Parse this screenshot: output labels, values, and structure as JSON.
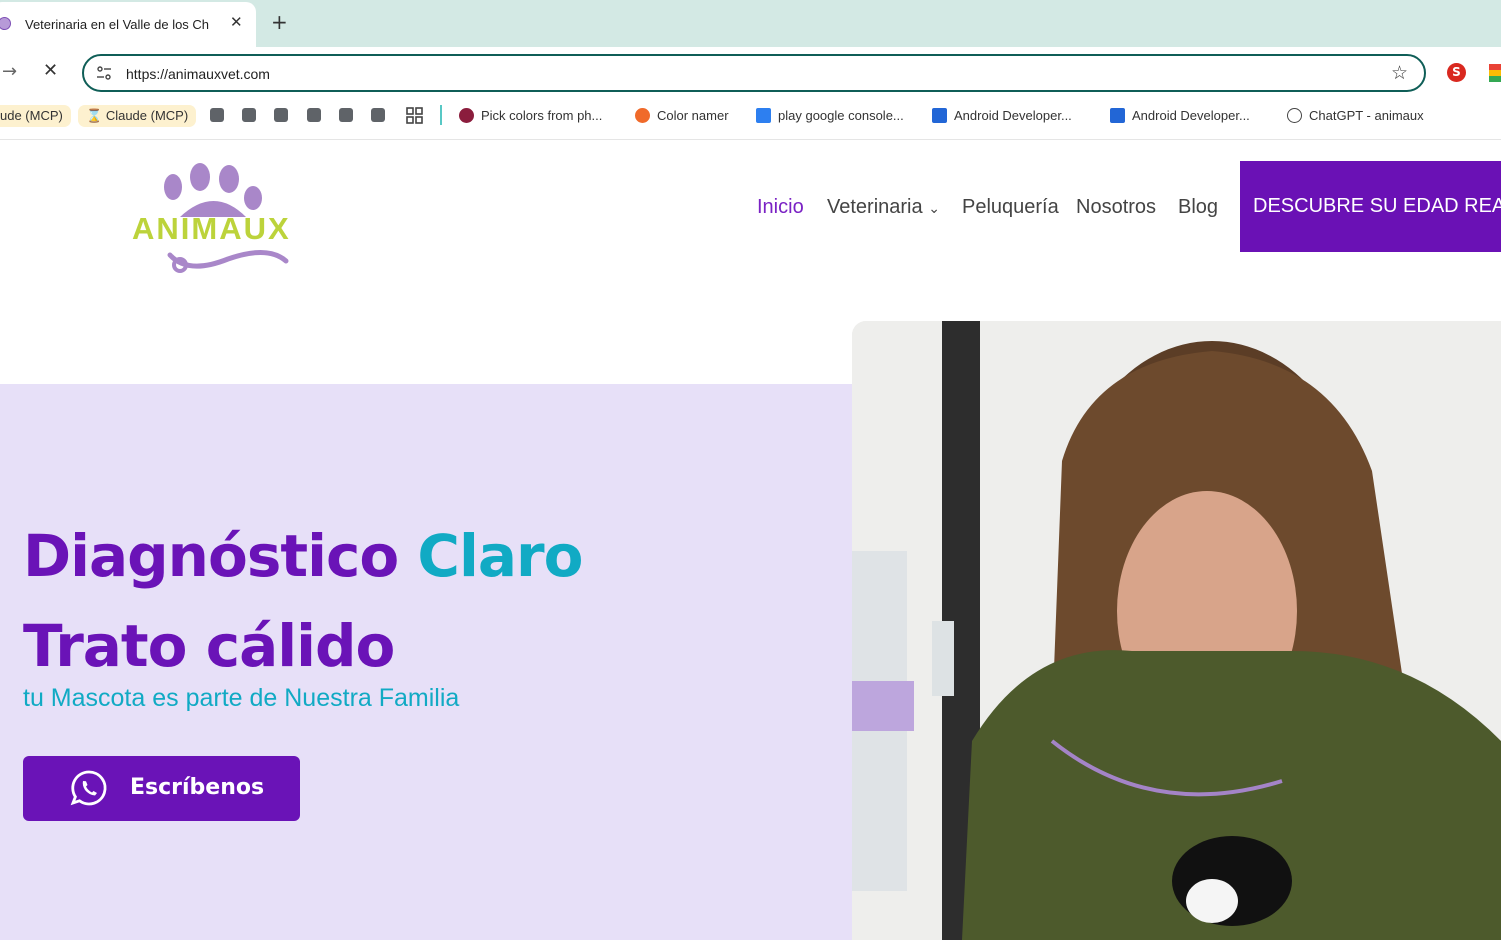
{
  "browser": {
    "tab_title": "Veterinaria en el Valle de los Ch",
    "tab_close": "✕",
    "new_tab": "+",
    "url": "https://animauxvet.com",
    "bookmarks": [
      {
        "label": "ude (MCP)"
      },
      {
        "label": "Claude (MCP)"
      },
      {
        "label": "Pick colors from ph..."
      },
      {
        "label": "Color namer"
      },
      {
        "label": "play google console..."
      },
      {
        "label": "Android Developer..."
      },
      {
        "label": "Android Developer..."
      },
      {
        "label": "ChatGPT - animaux"
      }
    ]
  },
  "site": {
    "logo_text": "ANIMAUX",
    "nav": [
      "Inicio",
      "Veterinaria",
      "Peluquería",
      "Nosotros",
      "Blog"
    ],
    "cta": "DESCUBRE SU EDAD REAL"
  },
  "hero": {
    "line1_a": "Diagnóstico",
    "line1_b": "Claro",
    "line2": "Trato cálido",
    "subtitle": "tu Mascota es parte de Nuestra Familia",
    "button": "Escríbenos"
  },
  "colors": {
    "brand_purple": "#6a13b7",
    "brand_teal": "#11aac4",
    "hero_bg": "#e7e0f8",
    "logo_green": "#bcd33b"
  }
}
